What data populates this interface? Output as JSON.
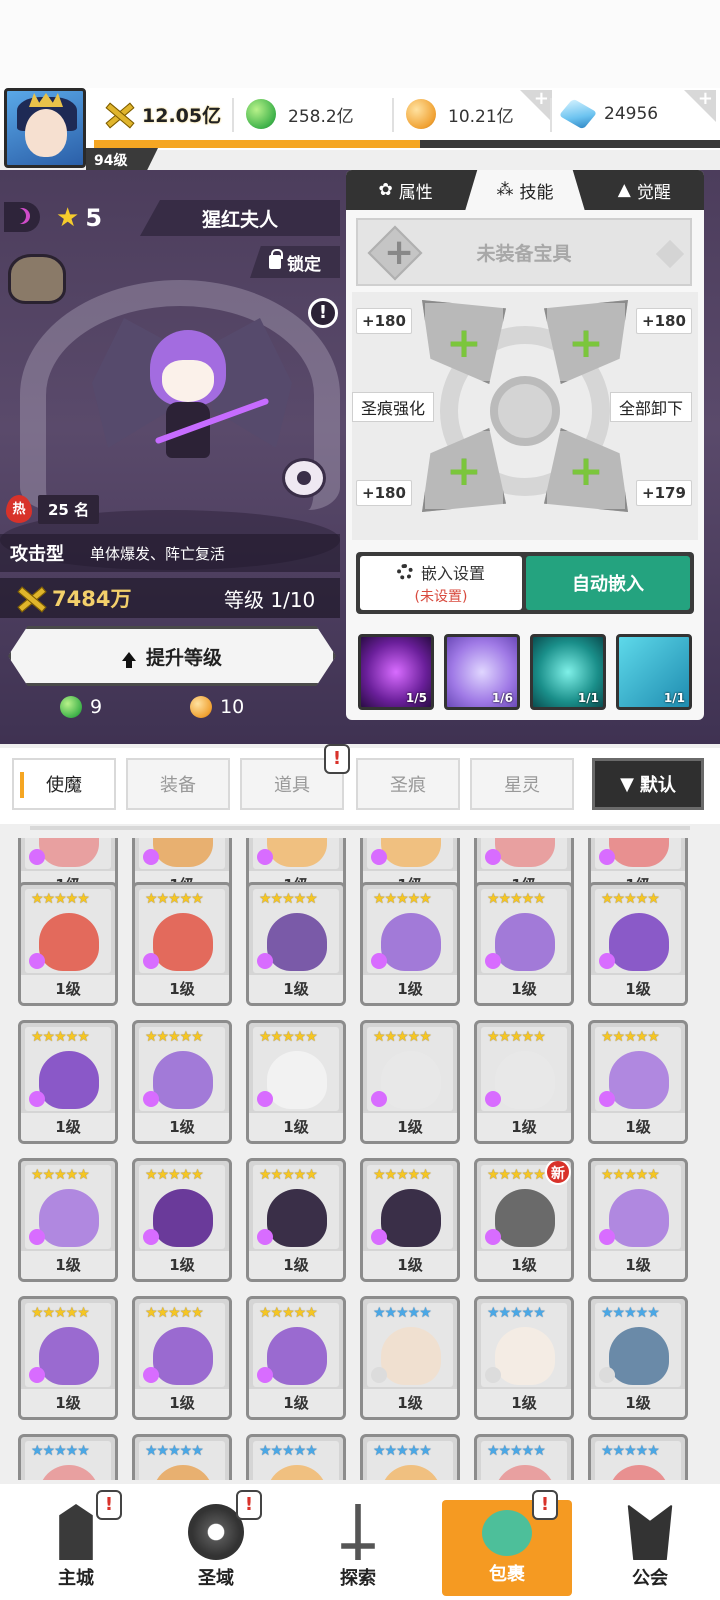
{
  "player": {
    "level_label": "94级",
    "exp_fraction": 0.52
  },
  "resources": {
    "power": "12.05亿",
    "green_orb": "258.2亿",
    "gold_coin": "10.21亿",
    "gems": "24956"
  },
  "hero": {
    "star_count": "5",
    "name": "猩红夫人",
    "lock_label": "锁定",
    "hot_rank_icon": "热",
    "hot_rank": "25 名",
    "type": "攻击型",
    "description": "单体爆发、阵亡复活",
    "power": "7484万",
    "level_text": "等级 1/10",
    "upgrade_label": "提升等级",
    "cost_green": "9",
    "cost_gold": "10"
  },
  "panel": {
    "tabs": [
      {
        "label": "属性",
        "icon": "attribute-icon"
      },
      {
        "label": "技能",
        "icon": "skill-icon"
      },
      {
        "label": "觉醒",
        "icon": "awaken-icon"
      }
    ],
    "active_tab": 1,
    "treasure_slot": "未装备宝具",
    "bonuses": [
      "+180",
      "+180",
      "+180",
      "+179"
    ],
    "enhance_label": "圣痕强化",
    "unequip_all_label": "全部卸下",
    "embed_settings_label": "嵌入设置",
    "embed_settings_status": "(未设置)",
    "auto_embed_label": "自动嵌入",
    "skills": [
      {
        "count": "1/5",
        "icon": "demon-skull-skill-icon"
      },
      {
        "count": "1/6",
        "icon": "cross-strike-skill-icon"
      },
      {
        "count": "1/1",
        "icon": "smile-aura-skill-icon"
      },
      {
        "count": "1/1",
        "icon": "multi-plus-skill-icon"
      }
    ]
  },
  "categories": {
    "items": [
      "使魔",
      "装备",
      "道具",
      "圣痕",
      "星灵"
    ],
    "active": 0,
    "sort_label": "默认",
    "alert_mark": "!"
  },
  "inventory": {
    "level_label": "1级",
    "rows": [
      [
        "#e8a0a0",
        "#e8b070",
        "#f0c080",
        "#f0c080",
        "#e8a0a0",
        "#e89090"
      ],
      [
        "#e36a5c",
        "#e36a5c",
        "#7a5aa8",
        "#a27ad8",
        "#a27ad8",
        "#8a5ac8"
      ],
      [
        "#8a58c8",
        "#a27ad8",
        "#f2f2f2",
        "#e8e8e8",
        "#e8e8e8",
        "#b088e0"
      ],
      [
        "#b088e0",
        "#6a3a9a",
        "#3a2f48",
        "#3a2f48",
        "#6a6a6a",
        "#b088e0"
      ],
      [
        "#9a6ad0",
        "#9a6ad0",
        "#9a6ad0",
        "#f0e0d0",
        "#f4ece4",
        "#6a8aa8"
      ]
    ],
    "new_badge": "新"
  },
  "nav": [
    {
      "label": "主城",
      "icon": "castle-icon"
    },
    {
      "label": "圣域",
      "icon": "vortex-icon"
    },
    {
      "label": "探索",
      "icon": "sword-explore-icon"
    },
    {
      "label": "包裹",
      "icon": "bag-icon"
    },
    {
      "label": "公会",
      "icon": "guild-helmet-icon"
    }
  ],
  "nav_active": 3,
  "colors": {
    "accent": "#f5a623",
    "auto_green": "#24a37f",
    "alert_red": "#d8322a"
  }
}
